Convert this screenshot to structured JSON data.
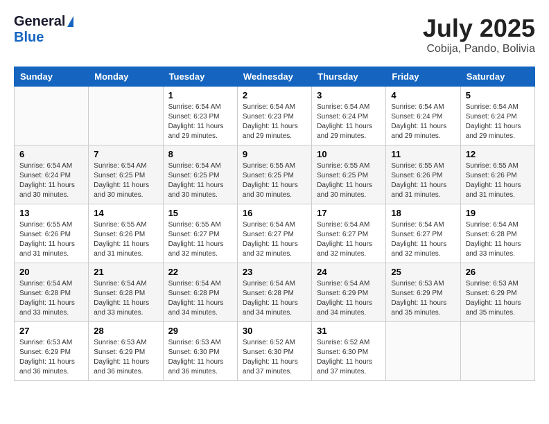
{
  "header": {
    "logo_line1": "General",
    "logo_line2": "Blue",
    "month": "July 2025",
    "location": "Cobija, Pando, Bolivia"
  },
  "weekdays": [
    "Sunday",
    "Monday",
    "Tuesday",
    "Wednesday",
    "Thursday",
    "Friday",
    "Saturday"
  ],
  "weeks": [
    [
      {
        "day": "",
        "info": ""
      },
      {
        "day": "",
        "info": ""
      },
      {
        "day": "1",
        "info": "Sunrise: 6:54 AM\nSunset: 6:23 PM\nDaylight: 11 hours and 29 minutes."
      },
      {
        "day": "2",
        "info": "Sunrise: 6:54 AM\nSunset: 6:23 PM\nDaylight: 11 hours and 29 minutes."
      },
      {
        "day": "3",
        "info": "Sunrise: 6:54 AM\nSunset: 6:24 PM\nDaylight: 11 hours and 29 minutes."
      },
      {
        "day": "4",
        "info": "Sunrise: 6:54 AM\nSunset: 6:24 PM\nDaylight: 11 hours and 29 minutes."
      },
      {
        "day": "5",
        "info": "Sunrise: 6:54 AM\nSunset: 6:24 PM\nDaylight: 11 hours and 29 minutes."
      }
    ],
    [
      {
        "day": "6",
        "info": "Sunrise: 6:54 AM\nSunset: 6:24 PM\nDaylight: 11 hours and 30 minutes."
      },
      {
        "day": "7",
        "info": "Sunrise: 6:54 AM\nSunset: 6:25 PM\nDaylight: 11 hours and 30 minutes."
      },
      {
        "day": "8",
        "info": "Sunrise: 6:54 AM\nSunset: 6:25 PM\nDaylight: 11 hours and 30 minutes."
      },
      {
        "day": "9",
        "info": "Sunrise: 6:55 AM\nSunset: 6:25 PM\nDaylight: 11 hours and 30 minutes."
      },
      {
        "day": "10",
        "info": "Sunrise: 6:55 AM\nSunset: 6:25 PM\nDaylight: 11 hours and 30 minutes."
      },
      {
        "day": "11",
        "info": "Sunrise: 6:55 AM\nSunset: 6:26 PM\nDaylight: 11 hours and 31 minutes."
      },
      {
        "day": "12",
        "info": "Sunrise: 6:55 AM\nSunset: 6:26 PM\nDaylight: 11 hours and 31 minutes."
      }
    ],
    [
      {
        "day": "13",
        "info": "Sunrise: 6:55 AM\nSunset: 6:26 PM\nDaylight: 11 hours and 31 minutes."
      },
      {
        "day": "14",
        "info": "Sunrise: 6:55 AM\nSunset: 6:26 PM\nDaylight: 11 hours and 31 minutes."
      },
      {
        "day": "15",
        "info": "Sunrise: 6:55 AM\nSunset: 6:27 PM\nDaylight: 11 hours and 32 minutes."
      },
      {
        "day": "16",
        "info": "Sunrise: 6:54 AM\nSunset: 6:27 PM\nDaylight: 11 hours and 32 minutes."
      },
      {
        "day": "17",
        "info": "Sunrise: 6:54 AM\nSunset: 6:27 PM\nDaylight: 11 hours and 32 minutes."
      },
      {
        "day": "18",
        "info": "Sunrise: 6:54 AM\nSunset: 6:27 PM\nDaylight: 11 hours and 32 minutes."
      },
      {
        "day": "19",
        "info": "Sunrise: 6:54 AM\nSunset: 6:28 PM\nDaylight: 11 hours and 33 minutes."
      }
    ],
    [
      {
        "day": "20",
        "info": "Sunrise: 6:54 AM\nSunset: 6:28 PM\nDaylight: 11 hours and 33 minutes."
      },
      {
        "day": "21",
        "info": "Sunrise: 6:54 AM\nSunset: 6:28 PM\nDaylight: 11 hours and 33 minutes."
      },
      {
        "day": "22",
        "info": "Sunrise: 6:54 AM\nSunset: 6:28 PM\nDaylight: 11 hours and 34 minutes."
      },
      {
        "day": "23",
        "info": "Sunrise: 6:54 AM\nSunset: 6:28 PM\nDaylight: 11 hours and 34 minutes."
      },
      {
        "day": "24",
        "info": "Sunrise: 6:54 AM\nSunset: 6:29 PM\nDaylight: 11 hours and 34 minutes."
      },
      {
        "day": "25",
        "info": "Sunrise: 6:53 AM\nSunset: 6:29 PM\nDaylight: 11 hours and 35 minutes."
      },
      {
        "day": "26",
        "info": "Sunrise: 6:53 AM\nSunset: 6:29 PM\nDaylight: 11 hours and 35 minutes."
      }
    ],
    [
      {
        "day": "27",
        "info": "Sunrise: 6:53 AM\nSunset: 6:29 PM\nDaylight: 11 hours and 36 minutes."
      },
      {
        "day": "28",
        "info": "Sunrise: 6:53 AM\nSunset: 6:29 PM\nDaylight: 11 hours and 36 minutes."
      },
      {
        "day": "29",
        "info": "Sunrise: 6:53 AM\nSunset: 6:30 PM\nDaylight: 11 hours and 36 minutes."
      },
      {
        "day": "30",
        "info": "Sunrise: 6:52 AM\nSunset: 6:30 PM\nDaylight: 11 hours and 37 minutes."
      },
      {
        "day": "31",
        "info": "Sunrise: 6:52 AM\nSunset: 6:30 PM\nDaylight: 11 hours and 37 minutes."
      },
      {
        "day": "",
        "info": ""
      },
      {
        "day": "",
        "info": ""
      }
    ]
  ]
}
